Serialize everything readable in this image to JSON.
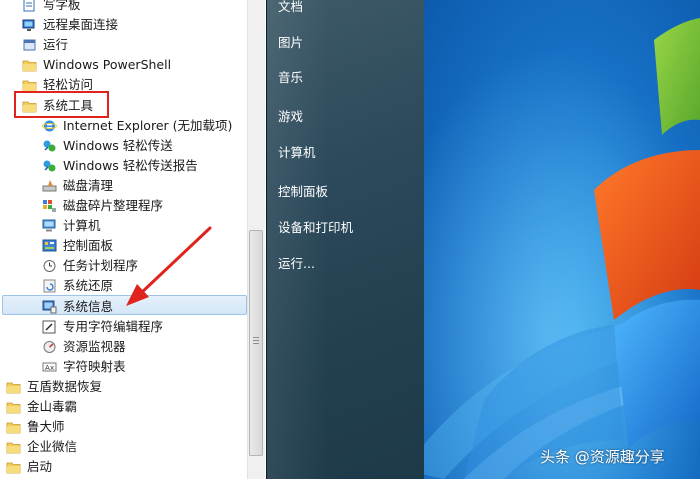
{
  "program_list": {
    "items": [
      {
        "label": "写字板",
        "icon": "wordpad-icon",
        "indent": 2
      },
      {
        "label": "远程桌面连接",
        "icon": "remote-desktop-icon",
        "indent": 2
      },
      {
        "label": "运行",
        "icon": "run-icon",
        "indent": 2
      },
      {
        "label": "Windows PowerShell",
        "icon": "folder-icon",
        "indent": 2
      },
      {
        "label": "轻松访问",
        "icon": "folder-icon",
        "indent": 2
      },
      {
        "label": "系统工具",
        "icon": "folder-icon",
        "indent": 2
      },
      {
        "label": "Internet Explorer (无加载项)",
        "icon": "internet-explorer-icon",
        "indent": 3
      },
      {
        "label": "Windows 轻松传送",
        "icon": "easy-transfer-icon",
        "indent": 3
      },
      {
        "label": "Windows 轻松传送报告",
        "icon": "easy-transfer-report-icon",
        "indent": 3
      },
      {
        "label": "磁盘清理",
        "icon": "disk-cleanup-icon",
        "indent": 3
      },
      {
        "label": "磁盘碎片整理程序",
        "icon": "defragmenter-icon",
        "indent": 3
      },
      {
        "label": "计算机",
        "icon": "computer-icon",
        "indent": 3
      },
      {
        "label": "控制面板",
        "icon": "control-panel-icon",
        "indent": 3
      },
      {
        "label": "任务计划程序",
        "icon": "task-scheduler-icon",
        "indent": 3
      },
      {
        "label": "系统还原",
        "icon": "system-restore-icon",
        "indent": 3
      },
      {
        "label": "系统信息",
        "icon": "system-information-icon",
        "indent": 3
      },
      {
        "label": "专用字符编辑程序",
        "icon": "private-character-editor-icon",
        "indent": 3
      },
      {
        "label": "资源监视器",
        "icon": "resource-monitor-icon",
        "indent": 3
      },
      {
        "label": "字符映射表",
        "icon": "character-map-icon",
        "indent": 3
      },
      {
        "label": "互盾数据恢复",
        "icon": "folder-icon",
        "indent": 1
      },
      {
        "label": "金山毒霸",
        "icon": "folder-icon",
        "indent": 1
      },
      {
        "label": "鲁大师",
        "icon": "folder-icon",
        "indent": 1
      },
      {
        "label": "企业微信",
        "icon": "folder-icon",
        "indent": 1
      },
      {
        "label": "启动",
        "icon": "folder-icon",
        "indent": 1
      }
    ],
    "selected": "系统信息",
    "highlighted": "系统工具"
  },
  "start_menu_right": {
    "items": [
      "文档",
      "图片",
      "音乐",
      "游戏",
      "计算机",
      "控制面板",
      "设备和打印机",
      "运行..."
    ]
  },
  "watermark": "头条 @资源趣分享",
  "colors": {
    "highlight_box": "#e0231c",
    "arrow": "#e0231c",
    "selection_fill": "#dbe9f8",
    "selection_border": "#9dc3e8",
    "right_pane_bg": "#2c4a5c",
    "desktop_blue": "#1a78cd",
    "windows_flag_orange": "#f07a16",
    "text": "#1a1a1a"
  }
}
